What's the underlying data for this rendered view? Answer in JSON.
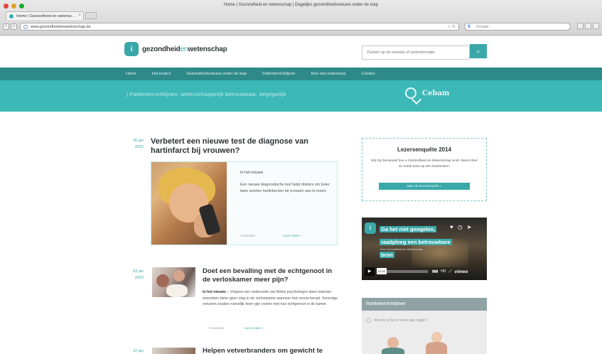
{
  "browser": {
    "window_title": "Home | Gezondheid en wetenschap | Dagelijks gezondheidsnieuws onder de loep",
    "tab_label": "Home | Gezondheid en wetensc...",
    "url": "www.gezondheidenwetenschap.be",
    "search_engine": "Google"
  },
  "site": {
    "logo_main": "gezondheid",
    "logo_en": "en",
    "logo_tail": "wetenschap",
    "logo_mark": "i",
    "search_placeholder": "Zoeken op de website of webinformatie",
    "nav": [
      "Home",
      "Het project",
      "Gezondheidsnieuws onder de loep",
      "Patiëntenrichtlijnen",
      "Kies een onderwerp",
      "Contact"
    ],
    "banner_text": "| Patiëntenrichtlijnen: wetenschappelijk betrouwbaar, begrijpelijk",
    "partner": "Cebam",
    "accent": "#3aa8a9",
    "nav_color": "#2d8a89"
  },
  "articles": [
    {
      "date_day": "26 jan",
      "date_year": "2015",
      "title": "Verbetert een nieuwe test de diagnose van hartinfarct bij vrouwen?",
      "category": "In het nieuws",
      "description": "Een nieuwe diagnostische test helpt dokters om beter twee soorten hartinfarcten bij vrouwen aan te tonen.",
      "meta": "2 reacties",
      "read_more": "Lees meer »"
    },
    {
      "date_day": "23 jan",
      "date_year": "2015",
      "title": "Doet een bevalling met de echtgenoot in de verloskamer meer pijn?",
      "lead": "In het nieuws",
      "body": " – Volgens een onderzoek van Britse psychologen doen mannen misschien beter geen stap in de verloskamer wanneer hun vrouw bevalt. Sommige vrouwen zouden namelijk meer pijn voelen met hun echtgenoot in de kamer.",
      "meta": "0 reacties",
      "read_more": "Lees meer »"
    },
    {
      "date_day": "22 jan",
      "title": "Helpen vetverbranders om gewicht te"
    }
  ],
  "sidebar": {
    "survey_title": "Lezersenquête 2014",
    "survey_desc": "Wij zijn benieuwd hoe u Gezondheid en Wetenschap vindt. Neem deel en maak kans op een boekenbon.",
    "survey_button": "Naar de lezersenquête »",
    "video_logo": "i",
    "video_title": "Ga het niet googelen, raadpleeg een betrouwbare bron",
    "video_sub": "from Gezondheid en Wetenschap",
    "video_time": "01:00",
    "video_brand": "vimeo",
    "video_hd": "HD",
    "patient_title": "Patiëntenrichtlijnen",
    "patient_line": "Wat doe je bij een acute lage rugpijn?"
  }
}
